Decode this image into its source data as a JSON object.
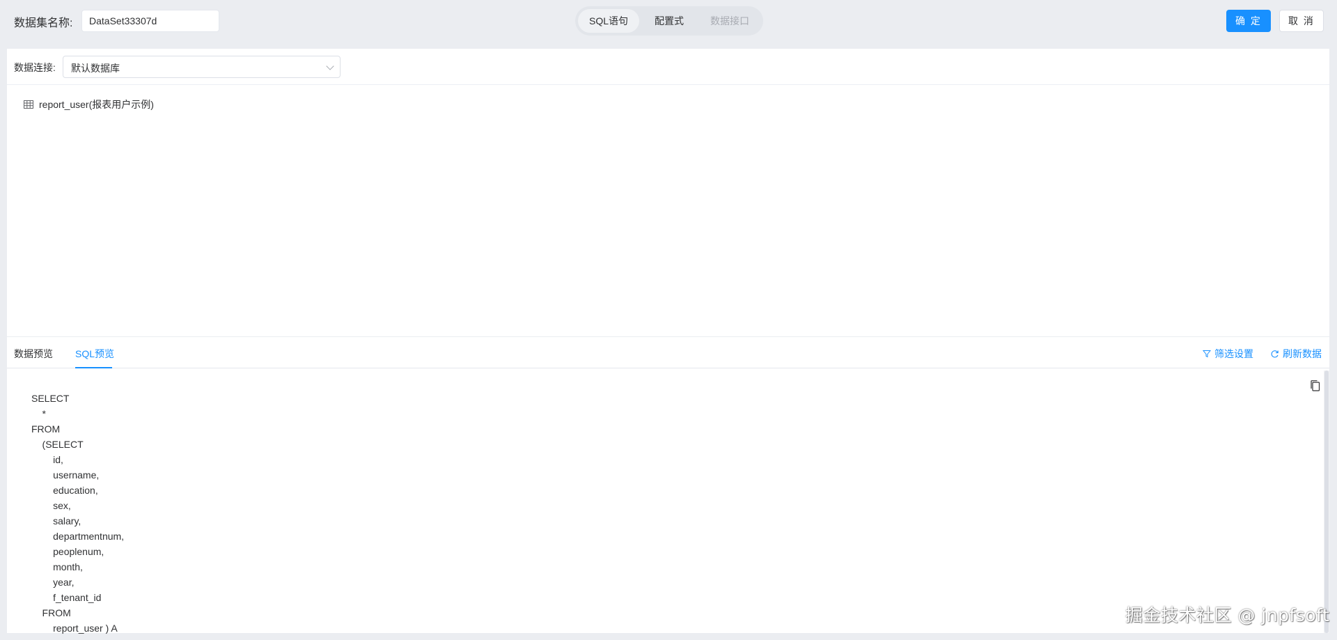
{
  "header": {
    "dataset_label": "数据集名称:",
    "dataset_name": "DataSet33307d",
    "segments": [
      "SQL语句",
      "配置式",
      "数据接口"
    ],
    "confirm": "确 定",
    "cancel": "取 消"
  },
  "connection": {
    "label": "数据连接:",
    "value": "默认数据库"
  },
  "tree": {
    "items": [
      {
        "label": "report_user(报表用户示例)",
        "icon": "table-icon"
      }
    ]
  },
  "preview": {
    "tabs": [
      "数据预览",
      "SQL预览"
    ],
    "active_tab": "SQL预览",
    "filter_label": "筛选设置",
    "refresh_label": "刷新数据",
    "sql_lines": [
      "SELECT",
      "    *",
      "FROM",
      "    (SELECT",
      "        id,",
      "        username,",
      "        education,",
      "        sex,",
      "        salary,",
      "        departmentnum,",
      "        peoplenum,",
      "        month,",
      "        year,",
      "        f_tenant_id",
      "    FROM",
      "        report_user ) A"
    ]
  },
  "watermark": "掘金技术社区 @ jnpfsoft",
  "colors": {
    "primary": "#1890ff",
    "background": "#ebedf1",
    "panel": "#ffffff"
  }
}
